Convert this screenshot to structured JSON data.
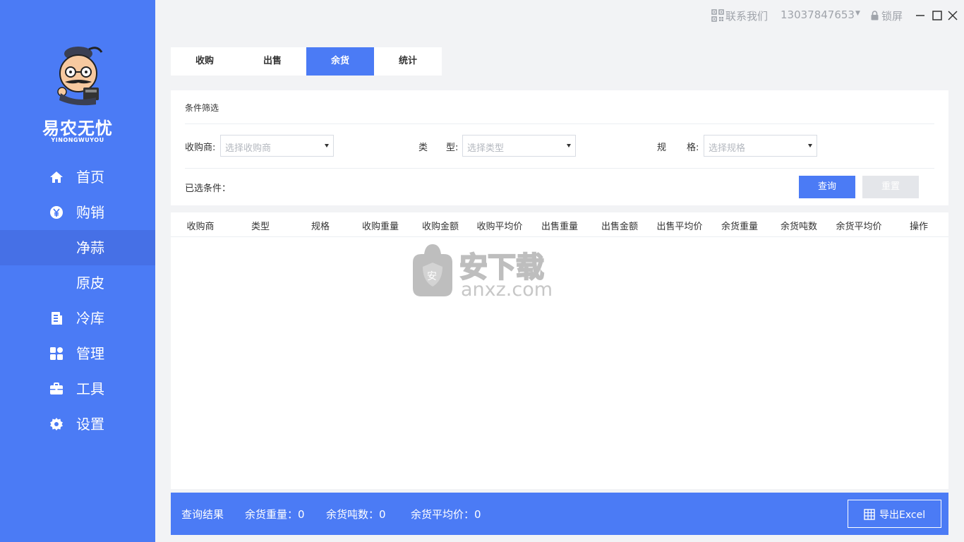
{
  "app": {
    "brand_name": "易农无忧",
    "brand_sub": "YINONGWUYOU"
  },
  "topbar": {
    "contact_label": "联系我们",
    "phone": "13037847653",
    "lock_label": "锁屏"
  },
  "sidebar": {
    "items": [
      {
        "label": "首页",
        "icon": "home-icon"
      },
      {
        "label": "购销",
        "icon": "yen-icon"
      },
      {
        "label": "净蒜",
        "icon": ""
      },
      {
        "label": "原皮",
        "icon": ""
      },
      {
        "label": "冷库",
        "icon": "document-icon"
      },
      {
        "label": "管理",
        "icon": "grid-icon"
      },
      {
        "label": "工具",
        "icon": "briefcase-icon"
      },
      {
        "label": "设置",
        "icon": "gear-icon"
      }
    ],
    "active_index": 2
  },
  "tabs": [
    {
      "label": "收购"
    },
    {
      "label": "出售"
    },
    {
      "label": "余货",
      "active": true
    },
    {
      "label": "统计"
    }
  ],
  "filter": {
    "title": "条件筛选",
    "buyer_label": "收购商:",
    "buyer_placeholder": "选择收购商",
    "type_label_1": "类",
    "type_label_2": "型:",
    "type_placeholder": "选择类型",
    "spec_label_1": "规",
    "spec_label_2": "格:",
    "spec_placeholder": "选择规格",
    "selected_label": "已选条件：",
    "query_button": "查询",
    "reset_button": "重置"
  },
  "table": {
    "columns": [
      "收购商",
      "类型",
      "规格",
      "收购重量",
      "收购金额",
      "收购平均价",
      "出售重量",
      "出售金额",
      "出售平均价",
      "余货重量",
      "余货吨数",
      "余货平均价",
      "操作"
    ],
    "rows": []
  },
  "watermark": {
    "text": "安下载",
    "sub": "anxz.com"
  },
  "bottom": {
    "result_label": "查询结果",
    "weight_label": "余货重量：0",
    "tons_label": "余货吨数：0",
    "avg_label": "余货平均价：0",
    "export_label": "导出Excel"
  },
  "colors": {
    "primary": "#4b7bf5",
    "active_nav": "#4670e6",
    "reset_disabled": "#e4e6ea"
  }
}
